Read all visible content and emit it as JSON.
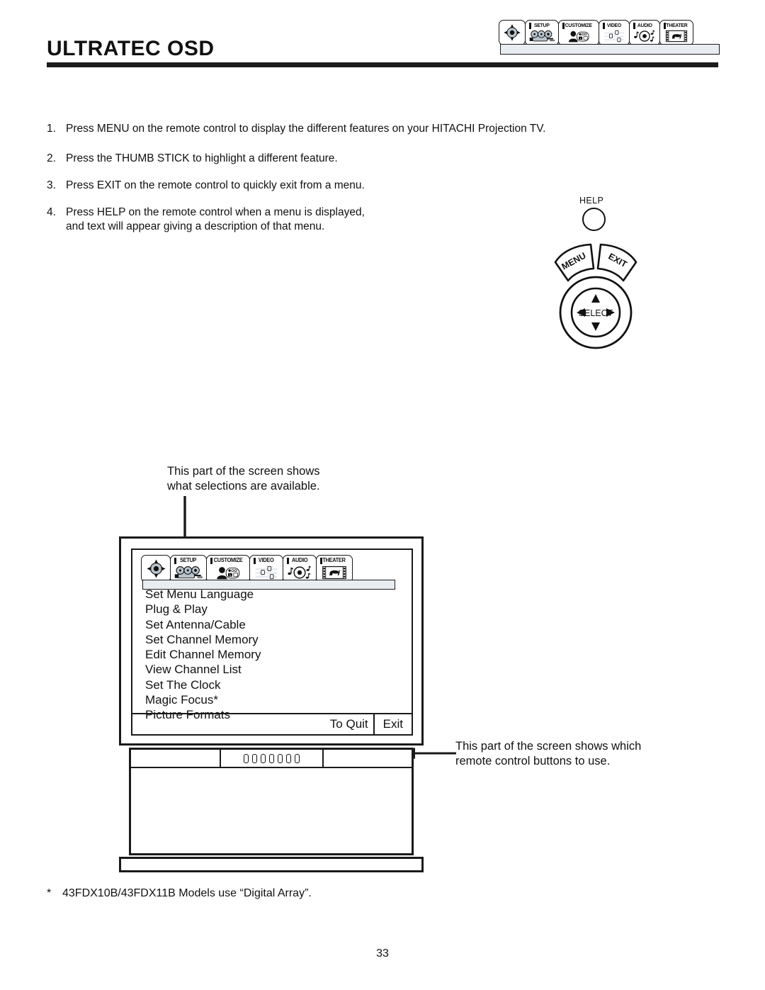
{
  "header": {
    "title": "ULTRATEC OSD",
    "tabs": [
      {
        "label": "",
        "icon": "thumbstick-icon",
        "name": "nav"
      },
      {
        "label": "SETUP",
        "icon": "setup-camera-icon",
        "name": "setup"
      },
      {
        "label": "CUSTOMIZE",
        "icon": "customize-person-icon",
        "name": "customize"
      },
      {
        "label": "VIDEO",
        "icon": "video-sliders-icon",
        "name": "video"
      },
      {
        "label": "AUDIO",
        "icon": "audio-disc-icon",
        "name": "audio"
      },
      {
        "label": "THEATER",
        "icon": "theater-filmstrip-icon",
        "name": "theater"
      }
    ]
  },
  "instructions": [
    {
      "num": "1.",
      "text": "Press MENU on the remote control to display the different features on your HITACHI Projection TV."
    },
    {
      "num": "2.",
      "text": "Press the THUMB STICK to highlight a different feature."
    },
    {
      "num": "3.",
      "text": "Press EXIT on the remote control to quickly exit from a menu."
    },
    {
      "num": "4.",
      "text": "Press HELP on the remote control when a menu is displayed,"
    },
    {
      "num": "",
      "text": "and text will appear giving a description of that menu."
    }
  ],
  "remote": {
    "help_label": "HELP",
    "menu_label": "MENU",
    "exit_label": "EXIT",
    "select_label": "SELECT"
  },
  "annotations": {
    "top": "This part of the screen shows\nwhat selections are available.",
    "top_line1": "This part of the screen shows",
    "top_line2": "what selections are available.",
    "right_line1": "This part of the screen shows which",
    "right_line2": "remote control buttons to use."
  },
  "tv": {
    "tabs": [
      {
        "label": "",
        "icon": "thumbstick-icon",
        "name": "nav"
      },
      {
        "label": "SETUP",
        "icon": "setup-camera-icon",
        "name": "setup"
      },
      {
        "label": "CUSTOMIZE",
        "icon": "customize-person-icon",
        "name": "customize"
      },
      {
        "label": "VIDEO",
        "icon": "video-sliders-icon",
        "name": "video"
      },
      {
        "label": "AUDIO",
        "icon": "audio-disc-icon",
        "name": "audio"
      },
      {
        "label": "THEATER",
        "icon": "theater-filmstrip-icon",
        "name": "theater"
      }
    ],
    "menu_items": [
      "Set Menu Language",
      "Plug & Play",
      "Set Antenna/Cable",
      "Set Channel Memory",
      "Edit Channel Memory",
      "View Channel List",
      "Set The Clock",
      "Magic Focus*",
      "Picture Formats"
    ],
    "quit_label": "To Quit",
    "exit_label": "Exit",
    "front_buttons": 7
  },
  "footnote": {
    "marker": "*",
    "text": "43FDX10B/43FDX11B Models use “Digital Array”."
  },
  "page_number": "33",
  "colors": {
    "ink": "#1a1a1a",
    "tab_fill": "#e8edf2",
    "icon_gray": "#b9c4cd"
  }
}
